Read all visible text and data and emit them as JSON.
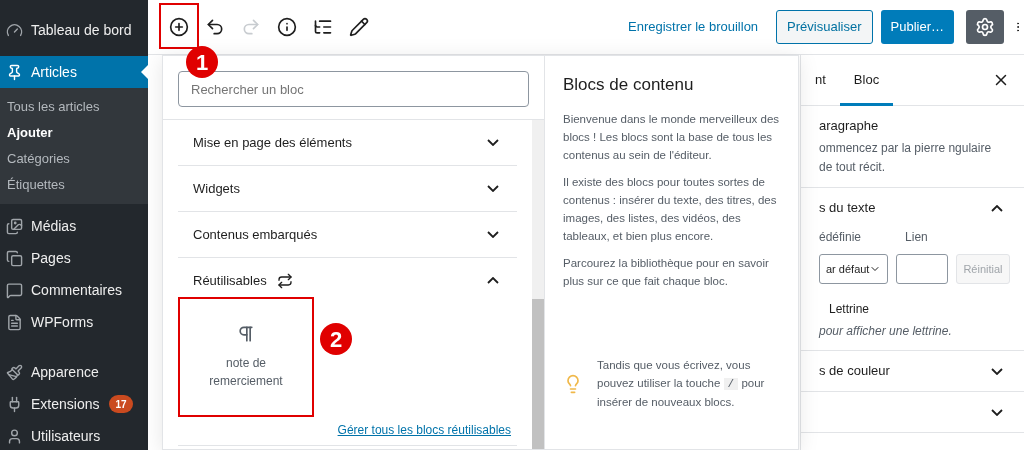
{
  "sidebar": {
    "items": [
      {
        "kind": "dashboard",
        "label": "Tableau de bord",
        "selected": false
      },
      {
        "kind": "pin",
        "label": "Articles",
        "selected": true,
        "children": [
          {
            "label": "Tous les articles",
            "selected": false
          },
          {
            "label": "Ajouter",
            "selected": true
          },
          {
            "label": "Catégories",
            "selected": false
          },
          {
            "label": "Étiquettes",
            "selected": false
          }
        ]
      },
      {
        "kind": "media",
        "label": "Médias",
        "selected": false
      },
      {
        "kind": "pages",
        "label": "Pages",
        "selected": false
      },
      {
        "kind": "comment",
        "label": "Commentaires",
        "selected": false
      },
      {
        "kind": "form",
        "label": "WPForms",
        "selected": false
      },
      {
        "kind": "brush",
        "label": "Apparence",
        "selected": false
      },
      {
        "kind": "plug",
        "label": "Extensions",
        "selected": false,
        "badge": "17"
      },
      {
        "kind": "user",
        "label": "Utilisateurs",
        "selected": false
      }
    ]
  },
  "toolbar": {
    "tools": [
      {
        "kind": "add",
        "disabled": false,
        "annotation": "1"
      },
      {
        "kind": "undo",
        "disabled": false
      },
      {
        "kind": "redo",
        "disabled": true
      },
      {
        "kind": "info",
        "disabled": false
      },
      {
        "kind": "outline",
        "disabled": false
      },
      {
        "kind": "edit",
        "disabled": false
      }
    ],
    "save_draft": "Enregistrer le brouillon",
    "preview": "Prévisualiser",
    "publish": "Publier…",
    "settings_pressed": true
  },
  "inserter": {
    "search": {
      "placeholder": "Rechercher un bloc"
    },
    "categories": [
      {
        "title": "Mise en page des éléments",
        "expanded": false
      },
      {
        "title": "Widgets",
        "expanded": false
      },
      {
        "title": "Contenus embarqués",
        "expanded": false
      },
      {
        "title": "Réutilisables",
        "expanded": true,
        "reusable": true,
        "blocks": [
          {
            "label": "note de remerciement",
            "annotation": "2"
          }
        ],
        "manage_link": "Gérer tous les blocs réutilisables"
      }
    ]
  },
  "help": {
    "title": "Blocs de contenu",
    "paragraphs": [
      "Bienvenue dans le monde merveilleux des blocs ! Les blocs sont la base de tous les contenus au sein de l'éditeur.",
      "Il existe des blocs pour toutes sortes de contenus : insérer du texte, des titres, des images, des listes, des vidéos, des tableaux, et bien plus encore.",
      "Parcourez la bibliothèque pour en savoir plus sur ce que fait chaque bloc."
    ],
    "tip": {
      "before": "Tandis que vous écrivez, vous pouvez utiliser la touche",
      "key": "/",
      "after": "pour insérer de nouveaux blocs."
    }
  },
  "settings_panel": {
    "tabs": [
      {
        "label": "nt",
        "selected": false
      },
      {
        "label": "Bloc",
        "selected": true
      }
    ],
    "block_title": "aragraphe",
    "block_description": [
      "ommencez par la pierre",
      "ngulaire de tout récit."
    ],
    "sections": [
      {
        "title": "s du texte",
        "expanded": true,
        "preset_label": "édéfinie",
        "link_label": "Lien",
        "select_value": "ar défaut",
        "reset": "Réinitial",
        "dropcap_label": "Lettrine",
        "dropcap_help": "pour afficher une lettrine."
      },
      {
        "title": "s de couleur",
        "expanded": false
      },
      {
        "expanded": false
      }
    ]
  }
}
